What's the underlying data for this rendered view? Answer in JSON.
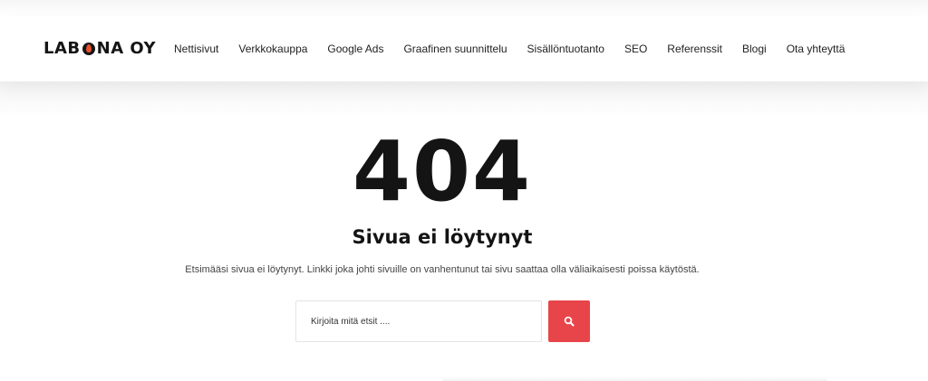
{
  "logo": {
    "part1": "LAB",
    "part2": "NA OY",
    "flame_color": "#e8512f"
  },
  "nav": {
    "items": [
      {
        "label": "Nettisivut"
      },
      {
        "label": "Verkkokauppa"
      },
      {
        "label": "Google Ads"
      },
      {
        "label": "Graafinen suunnittelu"
      },
      {
        "label": "Sisällöntuotanto"
      },
      {
        "label": "SEO"
      },
      {
        "label": "Referenssit"
      },
      {
        "label": "Blogi"
      },
      {
        "label": "Ota yhteyttä"
      }
    ]
  },
  "error": {
    "code": "404",
    "title": "Sivua ei löytynyt",
    "description": "Etsimääsi sivua ei löytynyt. Linkki joka johti sivuille on vanhentunut tai sivu saattaa olla väliaikaisesti poissa käytöstä."
  },
  "search": {
    "placeholder": "Kirjoita mitä etsit ....",
    "value": "",
    "button_icon": "search-icon",
    "button_color": "#e8454a"
  }
}
